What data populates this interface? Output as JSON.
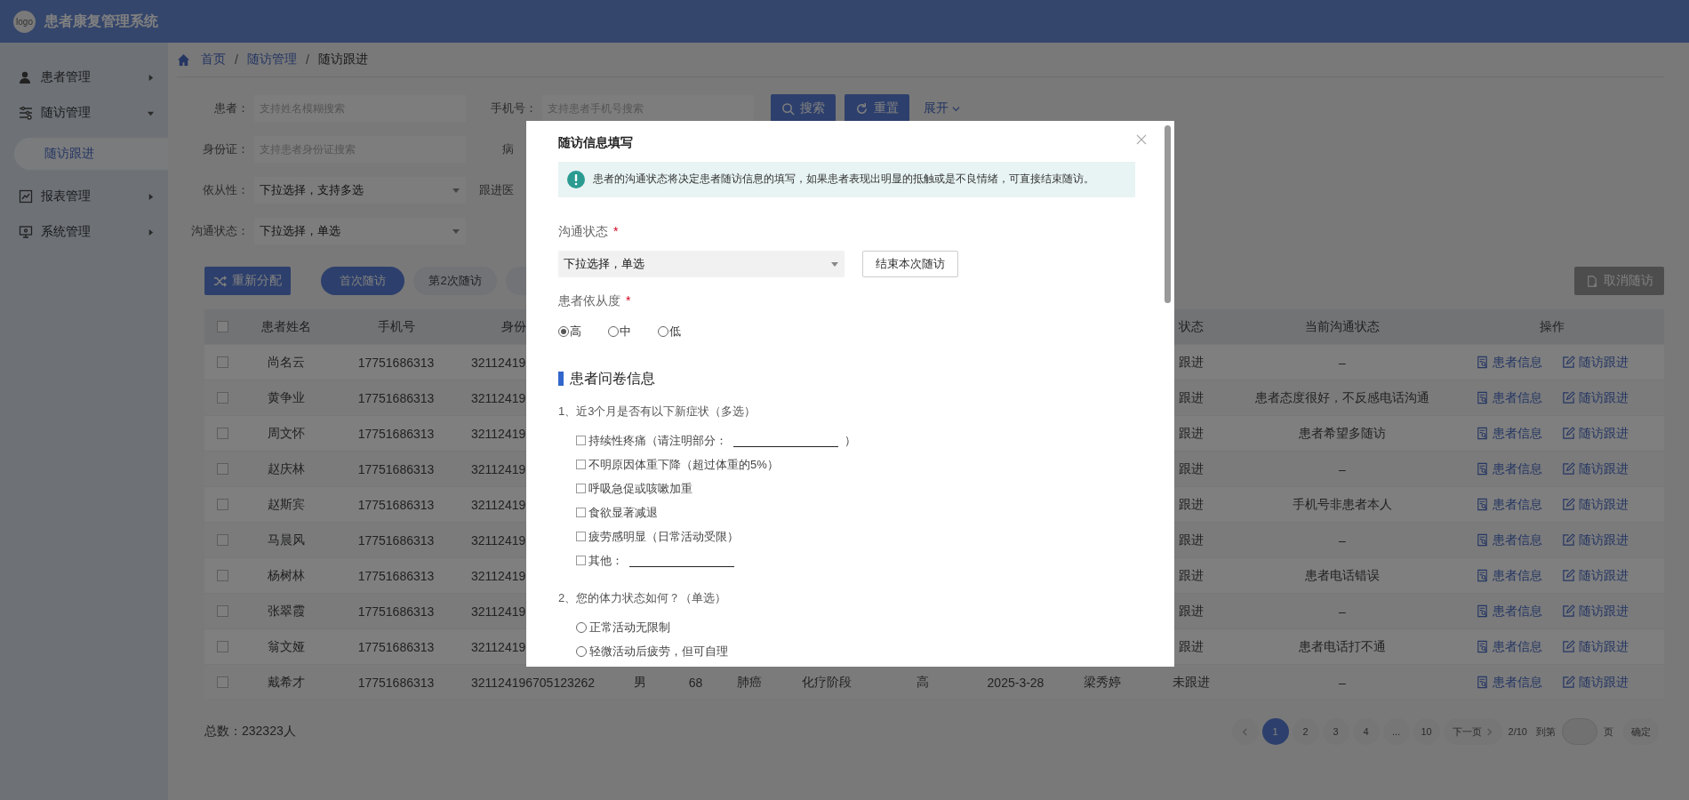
{
  "header": {
    "logo": "logo",
    "title": "患者康复管理系统"
  },
  "sidebar": {
    "items": [
      {
        "label": "患者管理",
        "expanded": false
      },
      {
        "label": "随访管理",
        "expanded": true,
        "children": [
          {
            "label": "随访跟进",
            "selected": true
          }
        ]
      },
      {
        "label": "报表管理",
        "expanded": false
      },
      {
        "label": "系统管理",
        "expanded": false
      }
    ]
  },
  "breadcrumb": {
    "items": [
      {
        "label": "首页",
        "link": true
      },
      {
        "label": "随访管理",
        "link": true
      },
      {
        "label": "随访跟进",
        "link": false
      }
    ],
    "separators": [
      "/",
      "/"
    ]
  },
  "filters": {
    "rows": [
      [
        {
          "kind": "input",
          "label": "患者：",
          "placeholder": "支持姓名模糊搜索"
        },
        {
          "kind": "input",
          "label": "手机号：",
          "placeholder": "支持患者手机号搜索"
        }
      ],
      [
        {
          "kind": "input",
          "label": "身份证：",
          "placeholder": "支持患者身份证搜索"
        },
        {
          "kind": "label",
          "label": "病"
        }
      ],
      [
        {
          "kind": "select",
          "label": "依从性：",
          "value": "下拉选择，支持多选"
        },
        {
          "kind": "label",
          "label": "跟进医"
        }
      ],
      [
        {
          "kind": "select",
          "label": "沟通状态：",
          "value": "下拉选择，单选"
        }
      ]
    ],
    "search": "搜索",
    "reset": "重置",
    "expand": "展开"
  },
  "toolbar": {
    "reassign": "重新分配",
    "visit_tabs": [
      {
        "label": "首次随访",
        "selected": true
      },
      {
        "label": "第2次随访",
        "selected": false
      },
      {
        "selected": false
      }
    ],
    "cancel": {
      "label": "取消随访",
      "disabled": true
    }
  },
  "table": {
    "header_checked": false,
    "columns": {
      "name": "患者姓名",
      "phone": "手机号",
      "id_number": "身份",
      "follow_status": "状态",
      "comm_status": "当前沟通状态",
      "actions": "操作"
    },
    "rows": [
      {
        "checked": false,
        "name": "尚名云",
        "phone": "17751686313",
        "id_number": "32112419",
        "follow_status": "跟进",
        "comm_status": "–",
        "actions": [
          "患者信息",
          "随访跟进"
        ]
      },
      {
        "checked": false,
        "name": "黄争业",
        "phone": "17751686313",
        "id_number": "32112419",
        "follow_status": "跟进",
        "comm_status": "患者态度很好，不反感电话沟通",
        "actions": [
          "患者信息",
          "随访跟进"
        ]
      },
      {
        "checked": false,
        "name": "周文怀",
        "phone": "17751686313",
        "id_number": "32112419",
        "follow_status": "跟进",
        "comm_status": "患者希望多随访",
        "actions": [
          "患者信息",
          "随访跟进"
        ]
      },
      {
        "checked": false,
        "name": "赵庆林",
        "phone": "17751686313",
        "id_number": "32112419",
        "follow_status": "跟进",
        "comm_status": "–",
        "actions": [
          "患者信息",
          "随访跟进"
        ]
      },
      {
        "checked": false,
        "name": "赵斯宾",
        "phone": "17751686313",
        "id_number": "32112419",
        "follow_status": "跟进",
        "comm_status": "手机号非患者本人",
        "actions": [
          "患者信息",
          "随访跟进"
        ]
      },
      {
        "checked": false,
        "name": "马晨风",
        "phone": "17751686313",
        "id_number": "32112419",
        "follow_status": "跟进",
        "comm_status": "–",
        "actions": [
          "患者信息",
          "随访跟进"
        ]
      },
      {
        "checked": false,
        "name": "杨树林",
        "phone": "17751686313",
        "id_number": "32112419",
        "follow_status": "跟进",
        "comm_status": "患者电话错误",
        "actions": [
          "患者信息",
          "随访跟进"
        ]
      },
      {
        "checked": false,
        "name": "张翠霞",
        "phone": "17751686313",
        "id_number": "32112419",
        "follow_status": "跟进",
        "comm_status": "–",
        "actions": [
          "患者信息",
          "随访跟进"
        ]
      },
      {
        "checked": false,
        "name": "翁文娅",
        "phone": "17751686313",
        "id_number": "32112419",
        "follow_status": "跟进",
        "comm_status": "患者电话打不通",
        "actions": [
          "患者信息",
          "随访跟进"
        ]
      },
      {
        "checked": false,
        "name": "戴希才",
        "phone": "17751686313",
        "id_number": "321124196705123262",
        "gender": "男",
        "age": "68",
        "disease": "肺癌",
        "stage": "化疗阶段",
        "compliance": "高",
        "date": "2025-3-28",
        "doctor": "梁秀婷",
        "follow_status": "未跟进",
        "comm_status": "–",
        "actions": [
          "患者信息",
          "随访跟进"
        ]
      }
    ]
  },
  "footer": {
    "total": "总数：232323人"
  },
  "pagination": {
    "pages": [
      {
        "label": "1",
        "selected": true
      },
      {
        "label": "2",
        "selected": false
      },
      {
        "label": "3",
        "selected": false
      },
      {
        "label": "4",
        "selected": false
      },
      {
        "label": "...",
        "selected": false
      },
      {
        "label": "10",
        "selected": false
      }
    ],
    "next": "下一页",
    "page_info": "2/10",
    "goto": "到第",
    "unit": "页",
    "confirm": "确定"
  },
  "modal": {
    "title": "随访信息填写",
    "alert": "患者的沟通状态将决定患者随访信息的填写，如果患者表现出明显的抵触或是不良情绪，可直接结束随访。",
    "comm_status": {
      "label": "沟通状态",
      "required_mark": "*",
      "value": "下拉选择，单选"
    },
    "end_button": "结束本次随访",
    "compliance": {
      "label": "患者依从度",
      "required_mark": "*",
      "options": [
        {
          "label": "高",
          "selected": true
        },
        {
          "label": "中",
          "selected": false
        },
        {
          "label": "低",
          "selected": false
        }
      ]
    },
    "section": "患者问卷信息",
    "questions": [
      {
        "kind": "multi",
        "title": "1、近3个月是否有以下新症状（多选）",
        "options": [
          {
            "label": "持续性疼痛（请注明部分：",
            "checked": false,
            "blank": true,
            "suffix": "）"
          },
          {
            "label": "不明原因体重下降（超过体重的5%）",
            "checked": false
          },
          {
            "label": "呼吸急促或咳嗽加重",
            "checked": false
          },
          {
            "label": "食欲显著减退",
            "checked": false
          },
          {
            "label": "疲劳感明显（日常活动受限）",
            "checked": false
          },
          {
            "label": "其他：",
            "checked": false,
            "blank": true
          }
        ]
      },
      {
        "kind": "single",
        "title": "2、您的体力状态如何？（单选）",
        "options": [
          {
            "label": "正常活动无限制",
            "selected": false
          },
          {
            "label": "轻微活动后疲劳，但可自理",
            "selected": false
          }
        ]
      }
    ]
  }
}
